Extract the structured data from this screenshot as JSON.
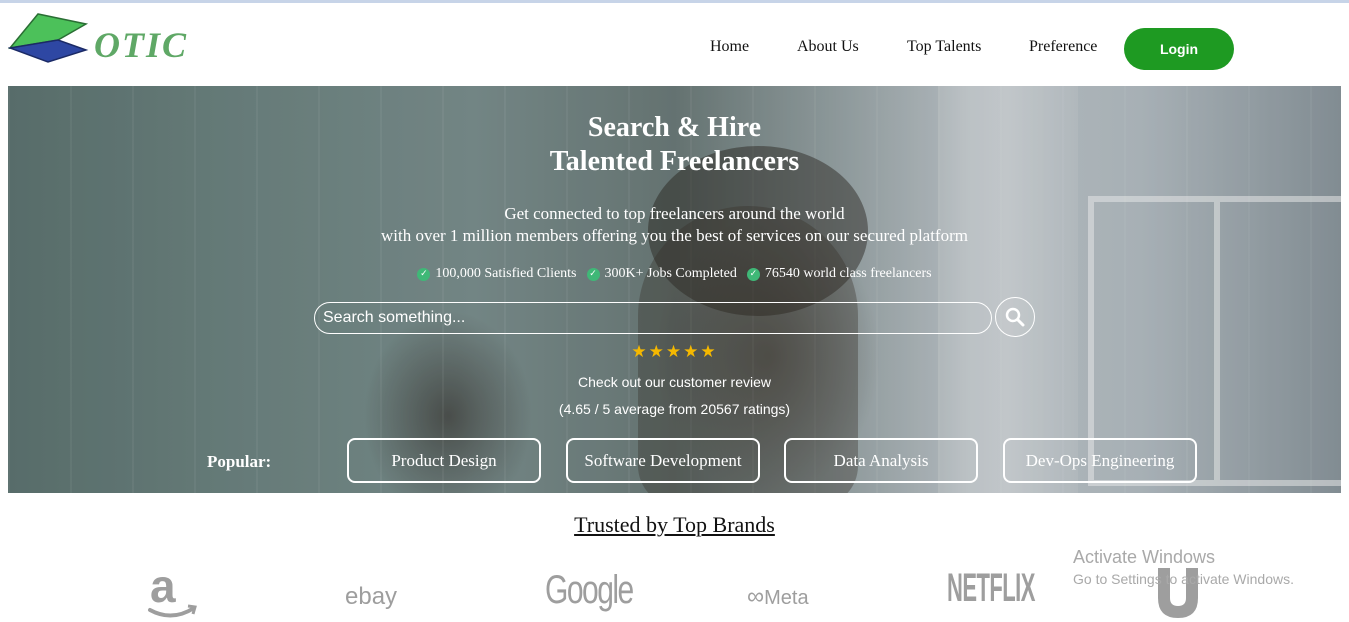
{
  "logo": {
    "text": "OTIC"
  },
  "nav": {
    "items": [
      "Home",
      "About Us",
      "Top Talents",
      "Preference"
    ],
    "login_label": "Login"
  },
  "hero": {
    "title_line1": "Search & Hire",
    "title_line2": "Talented Freelancers",
    "subtitle_line1": "Get connected to top freelancers around the world",
    "subtitle_line2": "with over 1 million members offering you the best of services on our secured platform",
    "stats": [
      "100,000 Satisfied Clients",
      "300K+ Jobs Completed",
      "76540 world class freelancers"
    ],
    "search_placeholder": "Search something...",
    "rating_stars": 5,
    "review_title": "Check out our customer review",
    "review_detail": "(4.65 / 5 average from 20567 ratings)",
    "popular_label": "Popular:",
    "popular_tags": [
      "Product Design",
      "Software Development",
      "Data Analysis",
      "Dev-Ops Engineering"
    ]
  },
  "trusted": {
    "heading": "Trusted by Top Brands",
    "brands": [
      "amazon",
      "ebay",
      "Google",
      "Meta",
      "NETFLIX",
      "Unilever"
    ]
  },
  "os_watermark": {
    "line1": "Activate Windows",
    "line2": "Go to Settings to activate Windows."
  },
  "colors": {
    "login_green": "#1e9a22",
    "star_yellow": "#f5b800",
    "check_green": "#3fb877",
    "logo_green": "#5fa866",
    "logo_blue": "#2e47a3"
  }
}
